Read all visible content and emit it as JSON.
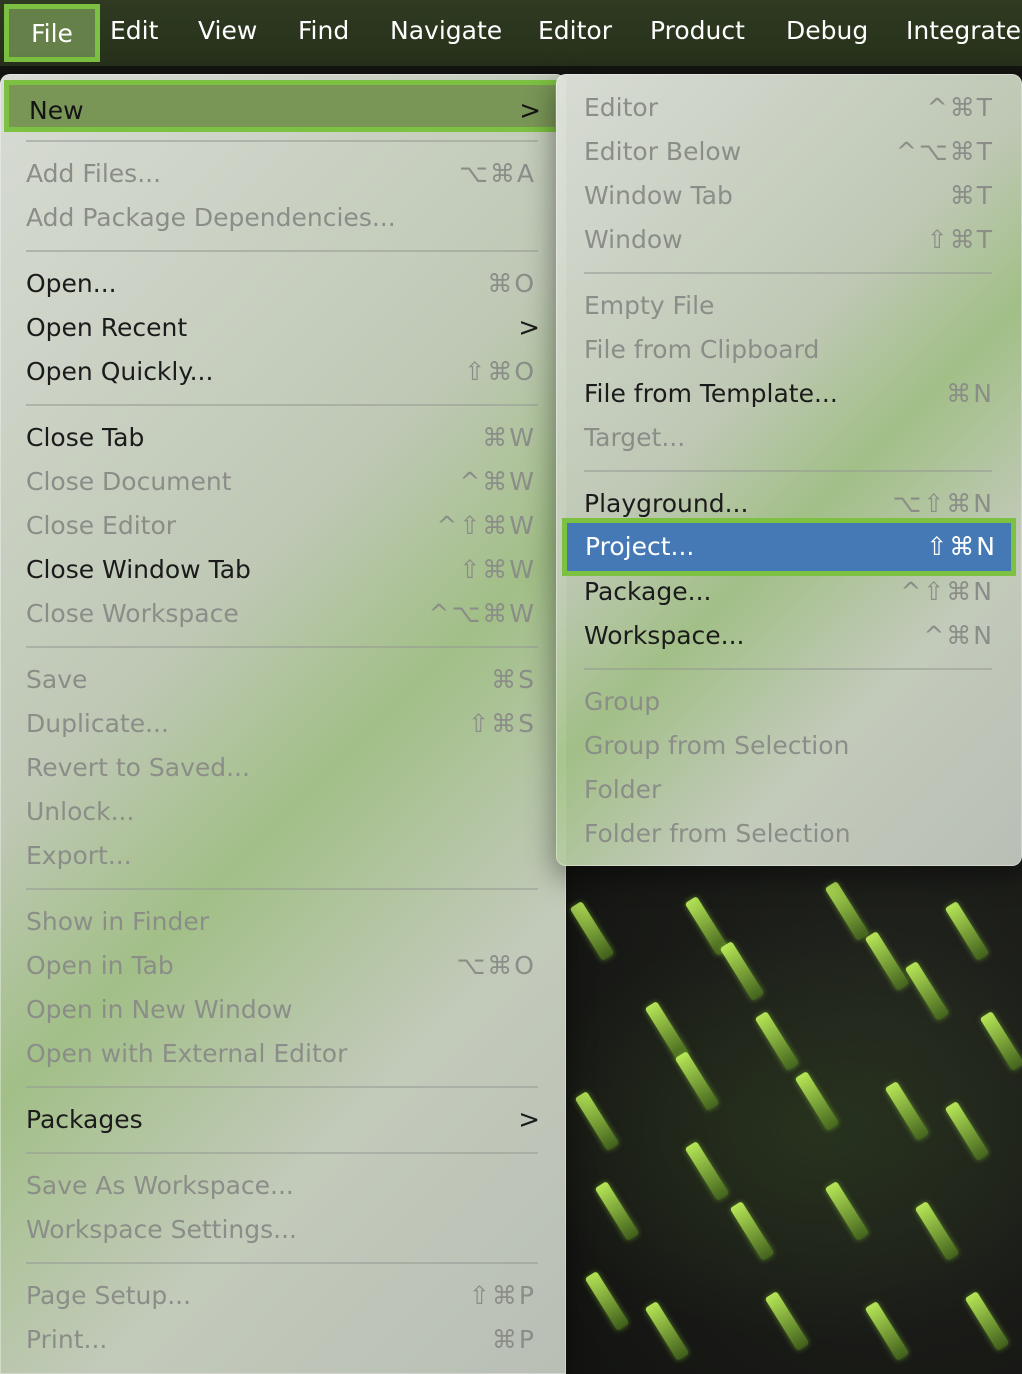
{
  "menubar": {
    "items": [
      "File",
      "Edit",
      "View",
      "Find",
      "Navigate",
      "Editor",
      "Product",
      "Debug",
      "Integrate"
    ]
  },
  "file_menu": {
    "new": {
      "label": "New",
      "chevron": ">"
    },
    "add_files": {
      "label": "Add Files...",
      "shortcut": "⌥⌘A"
    },
    "add_package_dependencies": {
      "label": "Add Package Dependencies..."
    },
    "open": {
      "label": "Open...",
      "shortcut": "⌘O"
    },
    "open_recent": {
      "label": "Open Recent",
      "chevron": ">"
    },
    "open_quickly": {
      "label": "Open Quickly...",
      "shortcut": "⇧⌘O"
    },
    "close_tab": {
      "label": "Close Tab",
      "shortcut": "⌘W"
    },
    "close_document": {
      "label": "Close Document",
      "shortcut": "^⌘W"
    },
    "close_editor": {
      "label": "Close Editor",
      "shortcut": "^⇧⌘W"
    },
    "close_window_tab": {
      "label": "Close Window Tab",
      "shortcut": "⇧⌘W"
    },
    "close_workspace": {
      "label": "Close Workspace",
      "shortcut": "^⌥⌘W"
    },
    "save": {
      "label": "Save",
      "shortcut": "⌘S"
    },
    "duplicate": {
      "label": "Duplicate...",
      "shortcut": "⇧⌘S"
    },
    "revert_to_saved": {
      "label": "Revert to Saved..."
    },
    "unlock": {
      "label": "Unlock..."
    },
    "export": {
      "label": "Export..."
    },
    "show_in_finder": {
      "label": "Show in Finder"
    },
    "open_in_tab": {
      "label": "Open in Tab",
      "shortcut": "⌥⌘O"
    },
    "open_in_new_window": {
      "label": "Open in New Window"
    },
    "open_with_external_editor": {
      "label": "Open with External Editor"
    },
    "packages": {
      "label": "Packages",
      "chevron": ">"
    },
    "save_as_workspace": {
      "label": "Save As Workspace..."
    },
    "workspace_settings": {
      "label": "Workspace Settings..."
    },
    "page_setup": {
      "label": "Page Setup...",
      "shortcut": "⇧⌘P"
    },
    "print": {
      "label": "Print...",
      "shortcut": "⌘P"
    }
  },
  "new_submenu": {
    "editor": {
      "label": "Editor",
      "shortcut": "^⌘T"
    },
    "editor_below": {
      "label": "Editor Below",
      "shortcut": "^⌥⌘T"
    },
    "window_tab": {
      "label": "Window Tab",
      "shortcut": "⌘T"
    },
    "window": {
      "label": "Window",
      "shortcut": "⇧⌘T"
    },
    "empty_file": {
      "label": "Empty File"
    },
    "file_from_clipboard": {
      "label": "File from Clipboard"
    },
    "file_from_template": {
      "label": "File from Template...",
      "shortcut": "⌘N"
    },
    "target": {
      "label": "Target..."
    },
    "playground": {
      "label": "Playground...",
      "shortcut": "⌥⇧⌘N"
    },
    "project": {
      "label": "Project...",
      "shortcut": "⇧⌘N"
    },
    "package": {
      "label": "Package...",
      "shortcut": "^⇧⌘N"
    },
    "workspace": {
      "label": "Workspace...",
      "shortcut": "^⌘N"
    },
    "group": {
      "label": "Group"
    },
    "group_from_selection": {
      "label": "Group from Selection"
    },
    "folder": {
      "label": "Folder"
    },
    "folder_from_selection": {
      "label": "Folder from Selection"
    }
  }
}
